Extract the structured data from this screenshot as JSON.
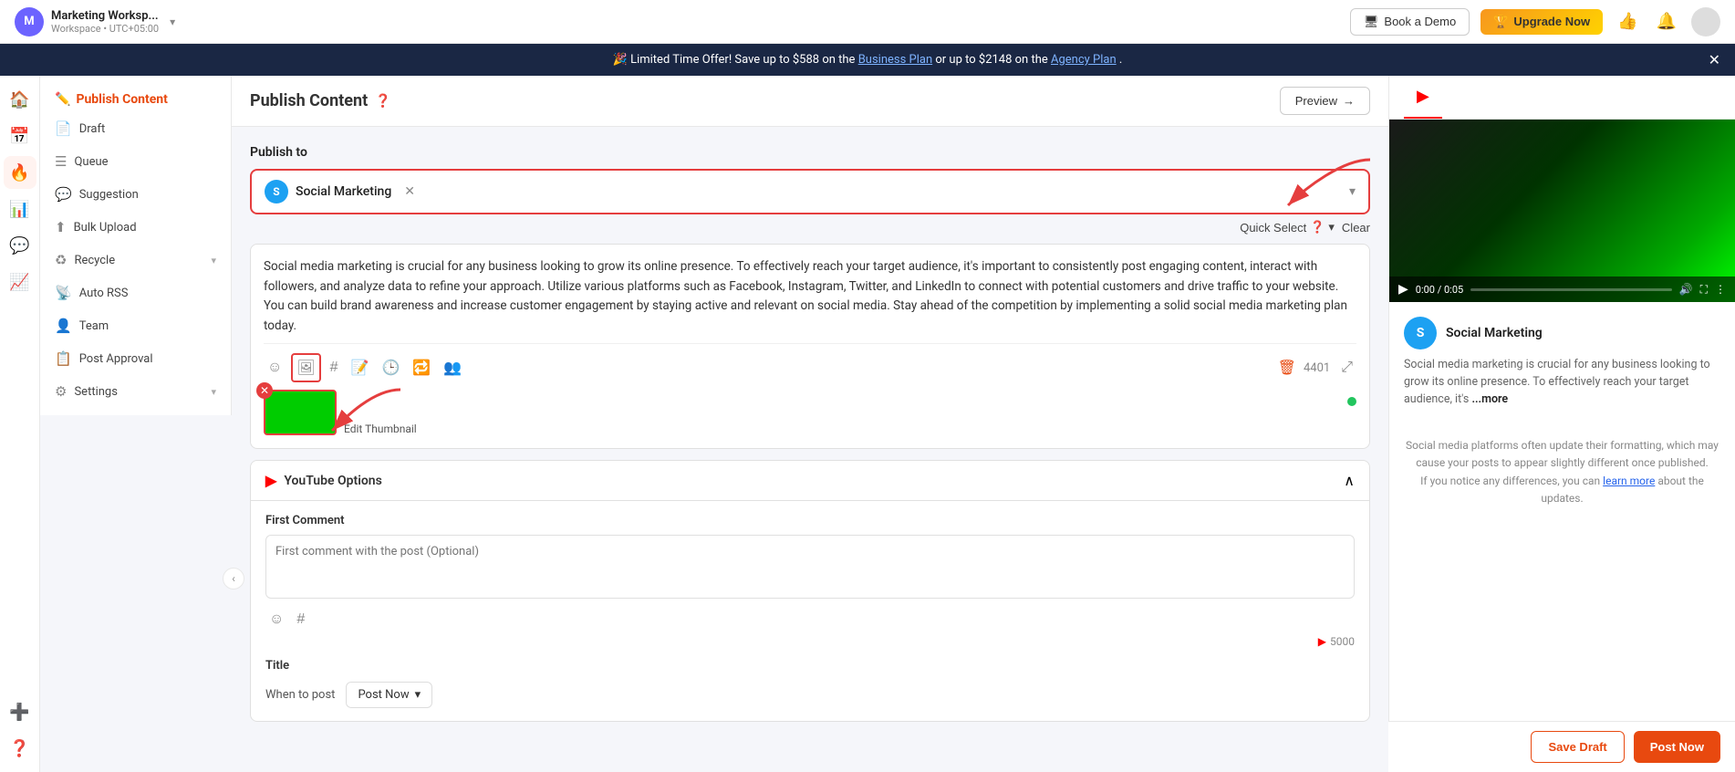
{
  "topNav": {
    "workspace": {
      "initial": "M",
      "name": "Marketing Worksp...",
      "sub": "Workspace • UTC+05:00"
    },
    "bookDemo": "Book a Demo",
    "upgradeNow": "Upgrade Now"
  },
  "banner": {
    "emoji": "🎉",
    "text": "Limited Time Offer! Save up to $588 on the ",
    "businessPlan": "Business Plan",
    "or": " or up to $2148 on the ",
    "agencyPlan": "Agency Plan",
    "end": "."
  },
  "sidebar": {
    "header": "Publish Content",
    "items": [
      {
        "label": "Draft",
        "icon": "📄"
      },
      {
        "label": "Queue",
        "icon": "☰"
      },
      {
        "label": "Suggestion",
        "icon": "💬"
      },
      {
        "label": "Bulk Upload",
        "icon": "⬆"
      },
      {
        "label": "Recycle",
        "icon": "♻",
        "hasArrow": true
      },
      {
        "label": "Auto RSS",
        "icon": "📡"
      },
      {
        "label": "Team",
        "icon": "👤"
      },
      {
        "label": "Post Approval",
        "icon": "📋"
      },
      {
        "label": "Settings",
        "icon": "⚙",
        "hasArrow": true
      }
    ]
  },
  "editor": {
    "title": "Publish Content",
    "previewBtn": "Preview",
    "publishToLabel": "Publish to",
    "publishToChannel": "Social Marketing",
    "quickSelect": "Quick Select",
    "clear": "Clear",
    "bodyText": "Social media marketing is crucial for any business looking to grow its online presence. To effectively reach your target audience, it's important to consistently post engaging content, interact with followers, and analyze data to refine your approach. Utilize various platforms such as Facebook, Instagram, Twitter, and LinkedIn to connect with potential customers and drive traffic to your website. You can build brand awareness and increase customer engagement by staying active and relevant on social media. Stay ahead of the competition by implementing a solid social media marketing plan today.",
    "charCount": "4401",
    "thumbnailLabel": "Edit Thumbnail",
    "ytOptions": {
      "title": "YouTube Options",
      "firstCommentLabel": "First Comment",
      "firstCommentPlaceholder": "First comment with the post (Optional)",
      "charLimit": "5000",
      "postTimeLabel": "When to post",
      "postNow": "Post Now"
    }
  },
  "preview": {
    "tabYt": "▶",
    "channelName": "Social Marketing",
    "channelInitial": "S",
    "previewText": "Social media marketing is crucial for any business looking to grow its online presence. To effectively reach your target audience, it's",
    "moreLabel": "...more",
    "timeDisplay": "0:00 / 0:05",
    "notice": "Social media platforms often update their formatting, which may cause your posts to appear slightly different once published.",
    "learnMore": "learn more",
    "noticeEnd": " about the updates."
  },
  "bottomBar": {
    "saveDraft": "Save Draft",
    "postNow": "Post Now"
  }
}
